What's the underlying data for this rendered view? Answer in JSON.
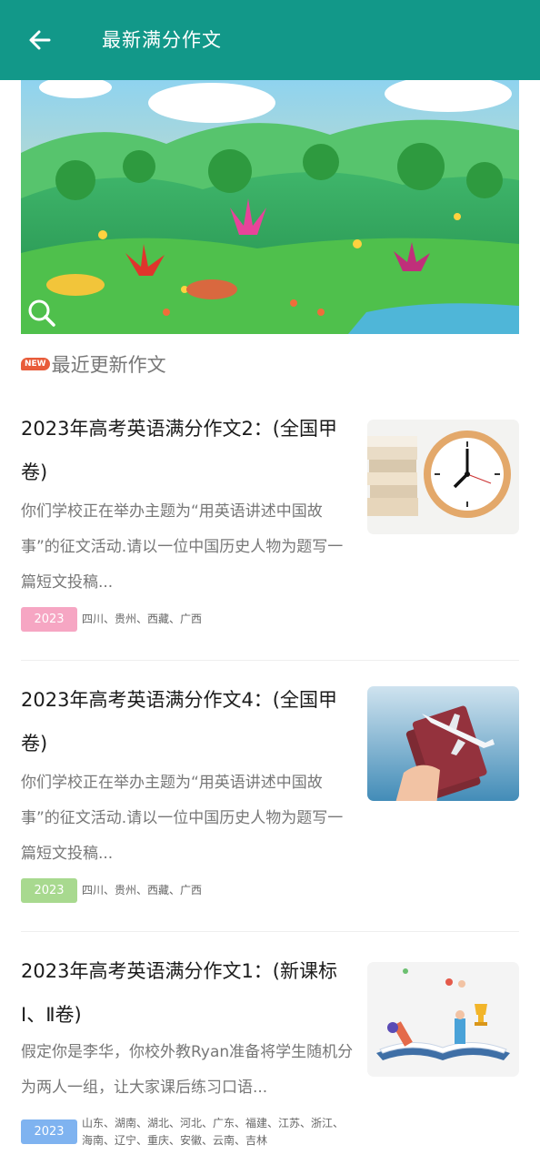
{
  "header": {
    "title": "最新满分作文",
    "back_icon": "arrow-left-icon"
  },
  "colors": {
    "primary": "#129889",
    "tag_pink": "#f6a6c3",
    "tag_green": "#a8d98f",
    "tag_blue": "#7fb3f0",
    "new_badge": "#e85c3a"
  },
  "section": {
    "badge": "NEW",
    "title": "最近更新作文"
  },
  "articles": [
    {
      "title": "2023年高考英语满分作文2：(全国甲卷)",
      "description": "你们学校正在举办主题为“用英语讲述中国故事”的征文活动.请以一位中国历史人物为题写一篇短文投稿...",
      "year": "2023",
      "regions": "四川、贵州、西藏、广西"
    },
    {
      "title": "2023年高考英语满分作文4：(全国甲卷)",
      "description": "你们学校正在举办主题为“用英语讲述中国故事”的征文活动.请以一位中国历史人物为题写一篇短文投稿...",
      "year": "2023",
      "regions": "四川、贵州、西藏、广西"
    },
    {
      "title": "2023年高考英语满分作文1：(新课标Ⅰ、Ⅱ卷)",
      "description": "假定你是李华，你校外教Ryan准备将学生随机分为两人一组，让大家课后练习口语...",
      "year": "2023",
      "regions": "山东、湖南、湖北、河北、广东、福建、江苏、浙江、海南、辽宁、重庆、安徽、云南、吉林"
    }
  ]
}
